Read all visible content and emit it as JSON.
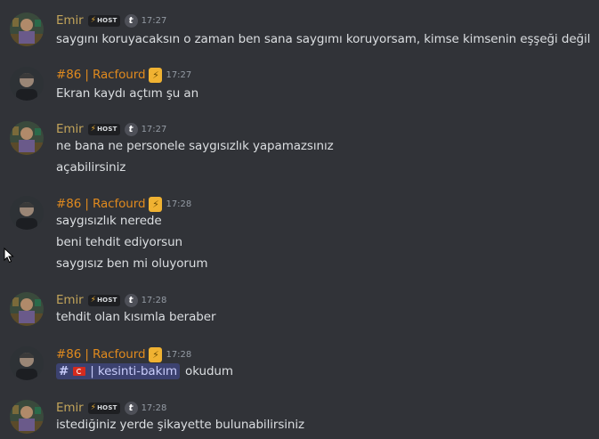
{
  "colors": {
    "background": "#313338",
    "emir_name": "#c2a45a",
    "racfourd_name": "#e08a1e",
    "text": "#dbdee1",
    "timestamp": "#949ba4"
  },
  "messages": [
    {
      "user": "Emir",
      "badge": "HOST",
      "tag_icon": "t",
      "time": "17:27",
      "lines": [
        "saygını koruyacaksın o zaman ben sana saygımı koruyorsam, kimse kimsenin eşşeği değil"
      ]
    },
    {
      "user": "#86 | Racfourd",
      "time": "17:27",
      "lines": [
        "Ekran kaydı açtım şu an"
      ]
    },
    {
      "user": "Emir",
      "badge": "HOST",
      "tag_icon": "t",
      "time": "17:27",
      "lines": [
        "ne bana ne personele saygısızlık yapamazsınız",
        "açabilirsiniz"
      ]
    },
    {
      "user": "#86 | Racfourd",
      "time": "17:28",
      "lines": [
        "saygısızlık nerede",
        "beni tehdit ediyorsun",
        "saygısız ben mi oluyorum"
      ]
    },
    {
      "user": "Emir",
      "badge": "HOST",
      "tag_icon": "t",
      "time": "17:28",
      "lines": [
        "tehdit olan kısımla beraber"
      ]
    },
    {
      "user": "#86 | Racfourd",
      "time": "17:28",
      "channel_mention": {
        "hash": "#",
        "name": "| kesinti-bakım"
      },
      "after_mention": "okudum"
    },
    {
      "user": "Emir",
      "badge": "HOST",
      "tag_icon": "t",
      "time": "17:28",
      "lines": [
        "istediğiniz yerde şikayette bulunabilirsiniz"
      ]
    }
  ]
}
